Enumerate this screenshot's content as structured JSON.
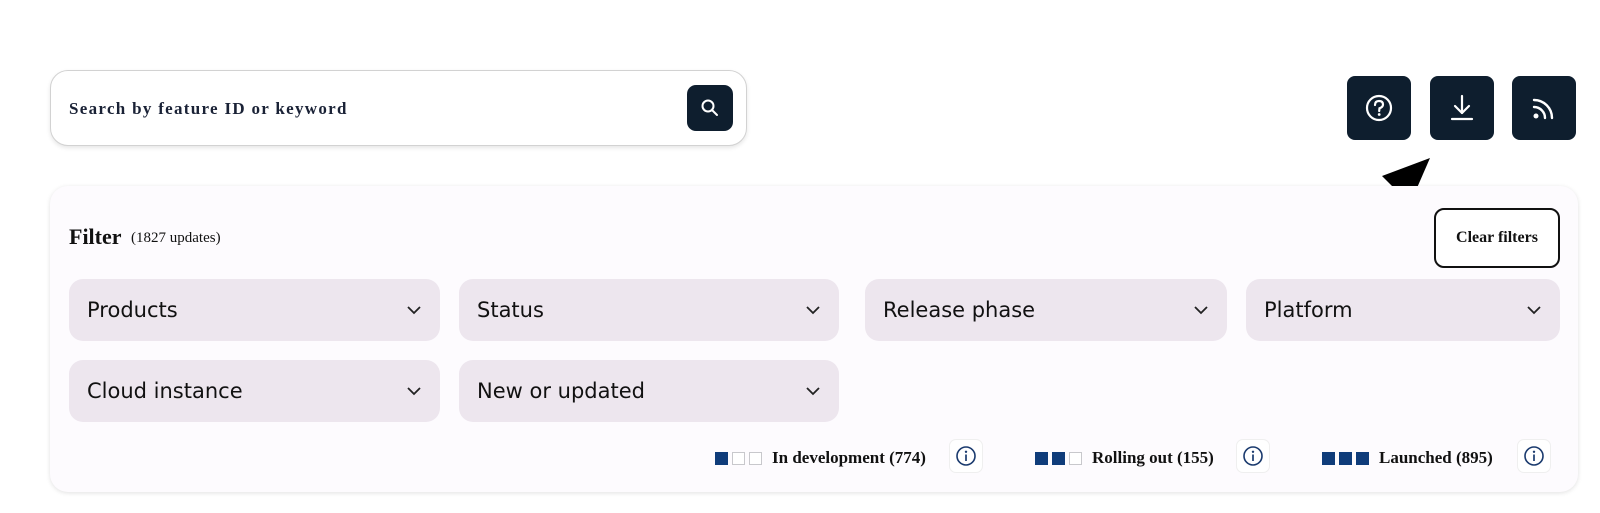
{
  "search": {
    "placeholder": "Search by feature ID or keyword",
    "icon": "magnifier"
  },
  "toolbar": {
    "help_icon": "question-circle",
    "download_icon": "download-arrow",
    "rss_icon": "rss-feed"
  },
  "filter": {
    "title": "Filter",
    "count": "(1827 updates)",
    "clear_label": "Clear filters",
    "dropdowns": [
      {
        "label": "Products"
      },
      {
        "label": "Status"
      },
      {
        "label": "Release phase"
      },
      {
        "label": "Platform"
      },
      {
        "label": "Cloud instance"
      },
      {
        "label": "New or updated"
      }
    ]
  },
  "legend": [
    {
      "label": "In development (774)",
      "filled": 1,
      "of": 3
    },
    {
      "label": "Rolling out (155)",
      "filled": 2,
      "of": 3
    },
    {
      "label": "Launched (895)",
      "filled": 3,
      "of": 3
    }
  ],
  "colors": {
    "dark_button": "#0e1e2e",
    "dropdown_bg": "#ede6ee",
    "status_fill": "#0f3c7a",
    "panel_bg": "#fdfbfe"
  }
}
